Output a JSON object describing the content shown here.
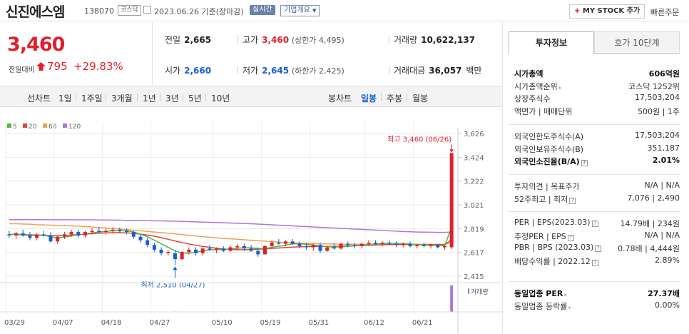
{
  "header": {
    "stock_name": "신진에스엠",
    "stock_code": "138070",
    "market_badge": "코스닥",
    "date_text": "2023.06.26 기준(장마감)",
    "realtime_label": "실시간",
    "corp_info_label": "기업개요",
    "my_stock_label": "MY STOCK 추가",
    "quick_order_label": "빠른주문"
  },
  "summary": {
    "current_price": "3,460",
    "compare_label": "전일대비",
    "change": "795",
    "change_rate": "+29.83%",
    "prev_close_label": "전일",
    "prev_close": "2,665",
    "high_label": "고가",
    "high": "3,460",
    "upper_limit_text": "(상한가 4,495)",
    "volume_label": "거래량",
    "volume": "10,622,137",
    "open_label": "시가",
    "open": "2,660",
    "low_label": "저가",
    "low": "2,645",
    "lower_limit_text": "(하한가 2,425)",
    "amount_label": "거래대금",
    "amount": "36,057",
    "amount_unit": "백만"
  },
  "period_bar": {
    "line_label": "선차트",
    "line_periods": [
      "1일",
      "1주일",
      "3개월",
      "1년",
      "3년",
      "5년",
      "10년"
    ],
    "candle_label": "봉차트",
    "candle_periods": [
      "일봉",
      "주봉",
      "월봉"
    ],
    "active_period": "일봉"
  },
  "chart_data": {
    "type": "candlestick",
    "legend": [
      "5",
      "20",
      "60",
      "120"
    ],
    "colors": {
      "ma5": "#4cba3c",
      "ma20": "#e8403a",
      "ma60": "#f0a050",
      "ma120": "#a77ad9",
      "up": "#e0202c",
      "down": "#1a5fd0",
      "volume": "#a77ad9"
    },
    "y_ticks": [
      "3,626",
      "3,424",
      "3,222",
      "3,021",
      "2,819",
      "2,617",
      "2,415"
    ],
    "ylim": [
      2415,
      3626
    ],
    "x_ticks": [
      "03/29",
      "04/07",
      "04/18",
      "04/27",
      "05/10",
      "05/19",
      "05/31",
      "06/12",
      "06/21"
    ],
    "volume_label": "거래량",
    "high_annotation": "최고 3,460 (06/26)",
    "low_annotation": "최저 2,510 (04/27)",
    "candles": [
      [
        2770,
        2800,
        2740,
        2760
      ],
      [
        2760,
        2790,
        2730,
        2780
      ],
      [
        2780,
        2810,
        2750,
        2760
      ],
      [
        2760,
        2790,
        2720,
        2740
      ],
      [
        2740,
        2780,
        2720,
        2770
      ],
      [
        2770,
        2800,
        2750,
        2760
      ],
      [
        2760,
        2790,
        2700,
        2710
      ],
      [
        2710,
        2760,
        2690,
        2750
      ],
      [
        2750,
        2790,
        2730,
        2770
      ],
      [
        2770,
        2810,
        2750,
        2790
      ],
      [
        2790,
        2810,
        2740,
        2760
      ],
      [
        2760,
        2800,
        2740,
        2790
      ],
      [
        2790,
        2820,
        2770,
        2800
      ],
      [
        2800,
        2830,
        2780,
        2790
      ],
      [
        2790,
        2820,
        2770,
        2800
      ],
      [
        2800,
        2830,
        2780,
        2810
      ],
      [
        2810,
        2830,
        2780,
        2800
      ],
      [
        2800,
        2820,
        2770,
        2790
      ],
      [
        2790,
        2800,
        2730,
        2750
      ],
      [
        2750,
        2770,
        2700,
        2720
      ],
      [
        2720,
        2740,
        2660,
        2680
      ],
      [
        2680,
        2700,
        2620,
        2640
      ],
      [
        2640,
        2660,
        2590,
        2610
      ],
      [
        2610,
        2640,
        2590,
        2620
      ],
      [
        2610,
        2640,
        2510,
        2560
      ],
      [
        2560,
        2630,
        2550,
        2620
      ],
      [
        2620,
        2660,
        2600,
        2640
      ],
      [
        2640,
        2660,
        2590,
        2610
      ],
      [
        2610,
        2660,
        2590,
        2650
      ],
      [
        2650,
        2680,
        2630,
        2640
      ],
      [
        2640,
        2660,
        2610,
        2650
      ],
      [
        2650,
        2670,
        2620,
        2630
      ],
      [
        2630,
        2670,
        2620,
        2660
      ],
      [
        2660,
        2690,
        2640,
        2670
      ],
      [
        2670,
        2690,
        2630,
        2650
      ],
      [
        2650,
        2680,
        2620,
        2630
      ],
      [
        2630,
        2660,
        2580,
        2600
      ],
      [
        2600,
        2680,
        2600,
        2670
      ],
      [
        2670,
        2720,
        2660,
        2700
      ],
      [
        2700,
        2730,
        2680,
        2690
      ],
      [
        2690,
        2720,
        2670,
        2710
      ],
      [
        2710,
        2730,
        2680,
        2690
      ],
      [
        2690,
        2710,
        2650,
        2670
      ],
      [
        2670,
        2700,
        2640,
        2660
      ],
      [
        2660,
        2690,
        2630,
        2680
      ],
      [
        2680,
        2700,
        2610,
        2630
      ],
      [
        2630,
        2670,
        2620,
        2660
      ],
      [
        2660,
        2690,
        2640,
        2650
      ],
      [
        2650,
        2700,
        2640,
        2690
      ],
      [
        2690,
        2710,
        2660,
        2680
      ],
      [
        2680,
        2700,
        2650,
        2670
      ],
      [
        2670,
        2700,
        2650,
        2690
      ],
      [
        2690,
        2720,
        2670,
        2700
      ],
      [
        2700,
        2720,
        2680,
        2690
      ],
      [
        2690,
        2710,
        2670,
        2700
      ],
      [
        2700,
        2720,
        2680,
        2690
      ],
      [
        2690,
        2710,
        2660,
        2680
      ],
      [
        2680,
        2700,
        2660,
        2690
      ],
      [
        2690,
        2710,
        2660,
        2670
      ],
      [
        2670,
        2690,
        2650,
        2680
      ],
      [
        2680,
        2700,
        2660,
        2670
      ],
      [
        2670,
        2690,
        2650,
        2680
      ],
      [
        2680,
        2690,
        2650,
        2660
      ],
      [
        2660,
        2680,
        2640,
        2670
      ],
      [
        2660,
        3460,
        2645,
        3460
      ]
    ],
    "ma5": [
      2770,
      2768,
      2766,
      2760,
      2762,
      2764,
      2750,
      2740,
      2746,
      2756,
      2766,
      2774,
      2782,
      2790,
      2796,
      2800,
      2800,
      2800,
      2790,
      2770,
      2750,
      2720,
      2690,
      2660,
      2630,
      2610,
      2610,
      2618,
      2630,
      2640,
      2640,
      2642,
      2646,
      2652,
      2656,
      2656,
      2650,
      2650,
      2660,
      2668,
      2678,
      2690,
      2690,
      2686,
      2680,
      2672,
      2666,
      2662,
      2664,
      2668,
      2672,
      2680,
      2684,
      2688,
      2692,
      2694,
      2694,
      2692,
      2688,
      2684,
      2680,
      2678,
      2676,
      2674,
      2830
    ],
    "ma20": [
      2770,
      2770,
      2768,
      2766,
      2764,
      2762,
      2760,
      2758,
      2760,
      2764,
      2768,
      2772,
      2776,
      2780,
      2782,
      2784,
      2784,
      2782,
      2778,
      2772,
      2764,
      2754,
      2742,
      2728,
      2714,
      2700,
      2688,
      2678,
      2668,
      2660,
      2652,
      2646,
      2642,
      2640,
      2640,
      2642,
      2644,
      2646,
      2650,
      2654,
      2658,
      2662,
      2664,
      2666,
      2668,
      2668,
      2668,
      2668,
      2670,
      2672,
      2674,
      2676,
      2678,
      2680,
      2682,
      2684,
      2684,
      2684,
      2684,
      2684,
      2684,
      2683,
      2682,
      2682,
      2722
    ],
    "ma60": [
      2860,
      2860,
      2858,
      2856,
      2852,
      2850,
      2848,
      2846,
      2844,
      2842,
      2840,
      2836,
      2832,
      2828,
      2824,
      2820,
      2815,
      2810,
      2805,
      2800,
      2795,
      2790,
      2785,
      2780,
      2774,
      2768,
      2762,
      2756,
      2750,
      2745,
      2740,
      2736,
      2732,
      2728,
      2724,
      2720,
      2716,
      2712,
      2708,
      2704,
      2700,
      2698,
      2696,
      2694,
      2692,
      2690,
      2689,
      2688,
      2687,
      2686,
      2686,
      2685,
      2685,
      2685,
      2684,
      2684,
      2684,
      2684,
      2684,
      2684,
      2685,
      2685,
      2686,
      2686,
      2700
    ],
    "ma120": [
      2895,
      2895,
      2895,
      2895,
      2895,
      2894,
      2894,
      2894,
      2894,
      2894,
      2893,
      2893,
      2893,
      2892,
      2892,
      2891,
      2890,
      2889,
      2888,
      2887,
      2886,
      2885,
      2884,
      2883,
      2882,
      2880,
      2878,
      2876,
      2874,
      2872,
      2870,
      2868,
      2866,
      2864,
      2862,
      2860,
      2857,
      2854,
      2851,
      2848,
      2845,
      2842,
      2839,
      2836,
      2833,
      2830,
      2827,
      2824,
      2821,
      2818,
      2815,
      2812,
      2809,
      2806,
      2803,
      2800,
      2797,
      2794,
      2792,
      2790,
      2789,
      2788,
      2787,
      2787,
      2790
    ],
    "volumes": [
      0.3,
      0.2,
      0.3,
      0.3,
      0.2,
      0.2,
      0.4,
      0.3,
      0.2,
      0.3,
      0.3,
      0.2,
      0.2,
      0.2,
      0.2,
      0.2,
      0.2,
      0.2,
      0.3,
      0.3,
      0.4,
      0.5,
      0.5,
      0.3,
      0.6,
      0.5,
      0.3,
      0.3,
      0.3,
      0.2,
      0.2,
      0.2,
      0.2,
      0.2,
      0.2,
      0.2,
      0.3,
      0.3,
      0.3,
      0.2,
      0.2,
      0.2,
      0.2,
      0.2,
      0.2,
      0.3,
      0.2,
      0.2,
      0.2,
      0.2,
      0.2,
      0.2,
      0.2,
      0.2,
      0.2,
      0.2,
      0.2,
      0.2,
      0.2,
      0.2,
      0.2,
      0.2,
      0.2,
      0.2,
      36
    ]
  },
  "info": {
    "tab_invest": "투자정보",
    "tab_hoga": "호가 10단계",
    "rows": [
      {
        "k": "시가총액",
        "v": "606억원",
        "bold": true,
        "group": 0
      },
      {
        "k": "시가총액순위",
        "v": "코스닥 1252위",
        "group": 0,
        "tri": true
      },
      {
        "k": "상장주식수",
        "v": "17,503,204",
        "group": 0
      },
      {
        "k": "액면가 | 매매단위",
        "v": "500원 | 1주",
        "group": 0
      },
      {
        "k": "외국인한도주식수(A)",
        "v": "17,503,204",
        "group": 1
      },
      {
        "k": "외국인보유주식수(B)",
        "v": "351,187",
        "group": 1
      },
      {
        "k": "외국인소진율(B/A)",
        "v": "2.01%",
        "bold": true,
        "group": 1,
        "qm": true
      },
      {
        "k": "투자의견 | 목표주가",
        "v": "N/A | N/A",
        "group": 2
      },
      {
        "k": "52주최고 | 최저",
        "v": "7,076 | 2,490",
        "group": 2,
        "qm": true
      },
      {
        "k": "PER | EPS(2023.03)",
        "v": "14.79배 | 234원",
        "group": 3,
        "qm": true
      },
      {
        "k": "추정PER | EPS",
        "v": "N/A | N/A",
        "group": 3,
        "qm": true
      },
      {
        "k": "PBR | BPS (2023.03)",
        "v": "0.78배 | 4,444원",
        "group": 3,
        "qm": true
      },
      {
        "k": "배당수익률 | 2022.12",
        "v": "2.89%",
        "group": 3,
        "qm": true
      },
      {
        "k": "동일업종 PER",
        "v": "27.37배",
        "bold": true,
        "group": 4,
        "tri": true
      },
      {
        "k": "동일업종 등락률",
        "v": "0.00%",
        "group": 4,
        "tri": true
      }
    ]
  }
}
